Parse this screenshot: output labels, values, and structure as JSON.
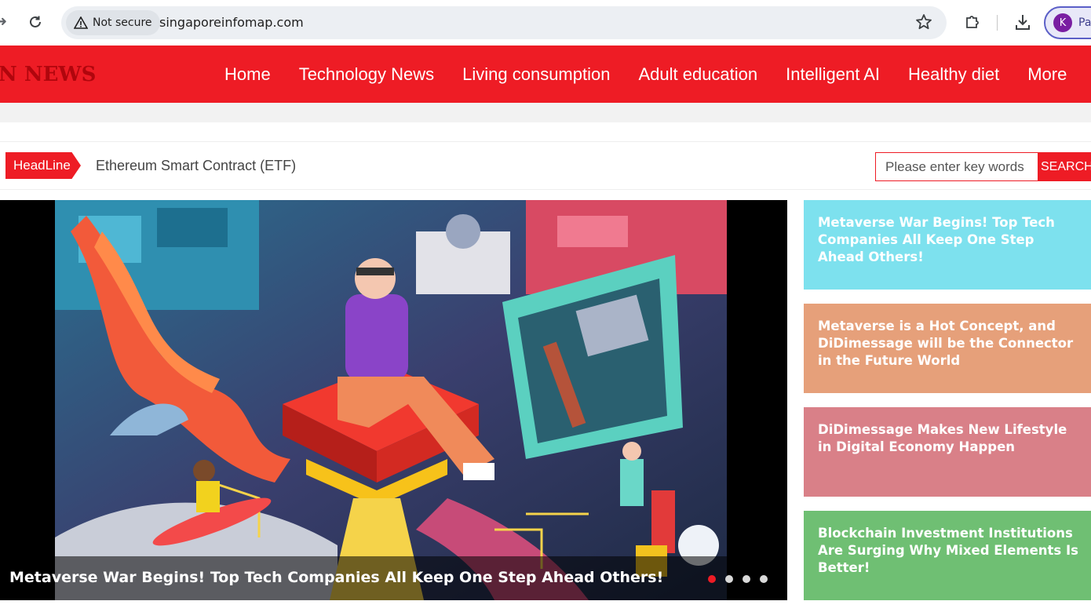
{
  "browser": {
    "security_label": "Not secure",
    "url": "singaporeinfomap.com",
    "profile_initial": "K",
    "profile_name": "Pa"
  },
  "site": {
    "logo": "N NEWS",
    "nav": [
      "Home",
      "Technology News",
      "Living consumption",
      "Adult education",
      "Intelligent AI",
      "Healthy diet",
      "More"
    ]
  },
  "headline": {
    "tag": "HeadLine",
    "text": "Ethereum Smart Contract (ETF)"
  },
  "search": {
    "placeholder": "Please enter key words",
    "button": "SEARCH"
  },
  "slider": {
    "caption": "Metaverse War Begins! Top Tech Companies All Keep One Step Ahead Others!",
    "slide_count": 4,
    "active_slide": 1
  },
  "side_articles": [
    {
      "title": "Metaverse War Begins! Top Tech Companies All Keep One Step Ahead Others!",
      "color": "#7de1ee"
    },
    {
      "title": "Metaverse is a Hot Concept, and DiDimessage will be the Connector in the Future World",
      "color": "#e6a07a"
    },
    {
      "title": "DiDimessage Makes New Lifestyle in Digital Economy Happen",
      "color": "#d98088"
    },
    {
      "title": "Blockchain Investment Institutions Are Surging Why Mixed Elements Is Better!",
      "color": "#6fbf73"
    }
  ],
  "colors": {
    "brand_red": "#ee1c25"
  }
}
